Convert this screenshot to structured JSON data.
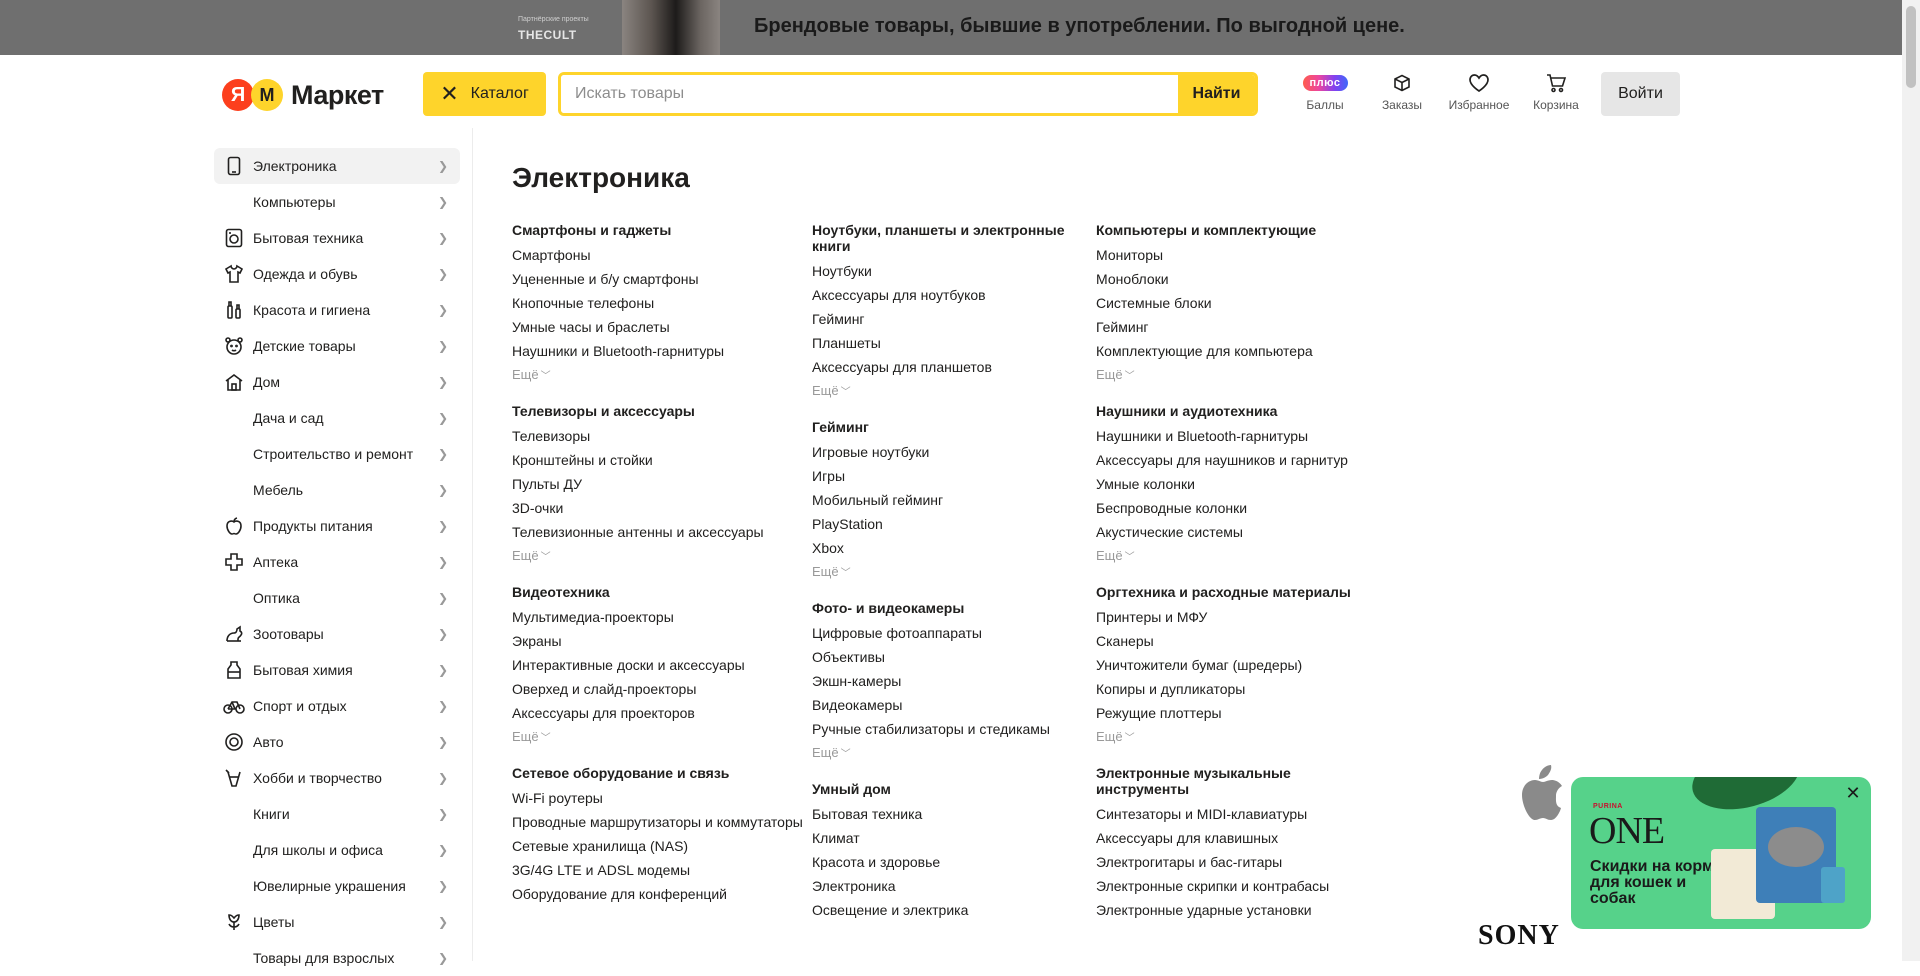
{
  "banner": {
    "small_text": "Партнёрские проекты",
    "logo_text": "THECULT",
    "headline": "Брендовые товары, бывшие в употреблении. По выгодной цене."
  },
  "header": {
    "logo_text": "Маркет",
    "logo_ya": "Я",
    "logo_m": "М",
    "catalog_label": "Каталог",
    "search_placeholder": "Искать товары",
    "find_label": "Найти",
    "plus_badge": "плюс",
    "items": [
      {
        "label": "Баллы",
        "icon": "plus-icon"
      },
      {
        "label": "Заказы",
        "icon": "box-icon"
      },
      {
        "label": "Избранное",
        "icon": "heart-icon"
      },
      {
        "label": "Корзина",
        "icon": "cart-icon"
      }
    ],
    "login_label": "Войти"
  },
  "sidebar": {
    "items": [
      {
        "label": "Электроника",
        "icon": "phone-icon",
        "active": true
      },
      {
        "label": "Компьютеры",
        "icon": ""
      },
      {
        "label": "Бытовая техника",
        "icon": "washer-icon"
      },
      {
        "label": "Одежда и обувь",
        "icon": "shirt-icon"
      },
      {
        "label": "Красота и гигиена",
        "icon": "brush-icon"
      },
      {
        "label": "Детские товары",
        "icon": "bear-icon"
      },
      {
        "label": "Дом",
        "icon": "house-icon"
      },
      {
        "label": "Дача и сад",
        "icon": ""
      },
      {
        "label": "Строительство и ремонт",
        "icon": ""
      },
      {
        "label": "Мебель",
        "icon": ""
      },
      {
        "label": "Продукты питания",
        "icon": "apple-icon"
      },
      {
        "label": "Аптека",
        "icon": "cross-icon"
      },
      {
        "label": "Оптика",
        "icon": ""
      },
      {
        "label": "Зоотовары",
        "icon": "pet-icon"
      },
      {
        "label": "Бытовая химия",
        "icon": "bottle-icon"
      },
      {
        "label": "Спорт и отдых",
        "icon": "bike-icon"
      },
      {
        "label": "Авто",
        "icon": "wheel-icon"
      },
      {
        "label": "Хобби и творчество",
        "icon": "brush-hobby-icon"
      },
      {
        "label": "Книги",
        "icon": ""
      },
      {
        "label": "Для школы и офиса",
        "icon": ""
      },
      {
        "label": "Ювелирные украшения",
        "icon": ""
      },
      {
        "label": "Цветы",
        "icon": "flower-icon"
      },
      {
        "label": "Товары для взрослых",
        "icon": ""
      }
    ]
  },
  "main": {
    "title": "Электроника",
    "more_label": "Ещё",
    "columns": [
      [
        {
          "title": "Смартфоны и гаджеты",
          "links": [
            "Смартфоны",
            "Уцененные и б/у смартфоны",
            "Кнопочные телефоны",
            "Умные часы и браслеты",
            "Наушники и Bluetooth-гарнитуры"
          ],
          "more": true
        },
        {
          "title": "Телевизоры и аксессуары",
          "links": [
            "Телевизоры",
            "Кронштейны и стойки",
            "Пульты ДУ",
            "3D-очки",
            "Телевизионные антенны и аксессуары"
          ],
          "more": true
        },
        {
          "title": "Видеотехника",
          "links": [
            "Мультимедиа-проекторы",
            "Экраны",
            "Интерактивные доски и аксессуары",
            "Оверхед и слайд-проекторы",
            "Аксессуары для проекторов"
          ],
          "more": true
        },
        {
          "title": "Сетевое оборудование и связь",
          "links": [
            "Wi-Fi роутеры",
            "Проводные маршрутизаторы и коммутаторы",
            "Сетевые хранилища (NAS)",
            "3G/4G LTE и ADSL модемы",
            "Оборудование для конференций"
          ],
          "more": false
        }
      ],
      [
        {
          "title": "Ноутбуки, планшеты и электронные книги",
          "links": [
            "Ноутбуки",
            "Аксессуары для ноутбуков",
            "Гейминг",
            "Планшеты",
            "Аксессуары для планшетов"
          ],
          "more": true
        },
        {
          "title": "Гейминг",
          "links": [
            "Игровые ноутбуки",
            "Игры",
            "Мобильный гейминг",
            "PlayStation",
            "Xbox"
          ],
          "more": true
        },
        {
          "title": "Фото- и видеокамеры",
          "links": [
            "Цифровые фотоаппараты",
            "Объективы",
            "Экшн-камеры",
            "Видеокамеры",
            "Ручные стабилизаторы и стедикамы"
          ],
          "more": true
        },
        {
          "title": "Умный дом",
          "links": [
            "Бытовая техника",
            "Климат",
            "Красота и здоровье",
            "Электроника",
            "Освещение и электрика"
          ],
          "more": false
        }
      ],
      [
        {
          "title": "Компьютеры и комплектующие",
          "links": [
            "Мониторы",
            "Моноблоки",
            "Системные блоки",
            "Гейминг",
            "Комплектующие для компьютера"
          ],
          "more": true
        },
        {
          "title": "Наушники и аудиотехника",
          "links": [
            "Наушники и Bluetooth-гарнитуры",
            "Аксессуары для наушников и гарнитур",
            "Умные колонки",
            "Беспроводные колонки",
            "Акустические системы"
          ],
          "more": true
        },
        {
          "title": "Оргтехника и расходные материалы",
          "links": [
            "Принтеры и МФУ",
            "Сканеры",
            "Уничтожители бумаг (шредеры)",
            "Копиры и дупликаторы",
            "Режущие плоттеры"
          ],
          "more": true
        },
        {
          "title": "Электронные музыкальные инструменты",
          "links": [
            "Синтезаторы и MIDI-клавиатуры",
            "Аксессуары для клавишных",
            "Электрогитары и бас-гитары",
            "Электронные скрипки и контрабасы",
            "Электронные ударные установки"
          ],
          "more": false
        }
      ]
    ]
  },
  "brands": {
    "sony": "SONY"
  },
  "popup": {
    "brand_small": "PURINA",
    "brand_big": "ONE",
    "text": "Скидки на корма для кошек и собак"
  },
  "colors": {
    "accent_yellow": "#fed42b",
    "ya_red": "#fc3f1d",
    "popup_green": "#56d28a"
  }
}
